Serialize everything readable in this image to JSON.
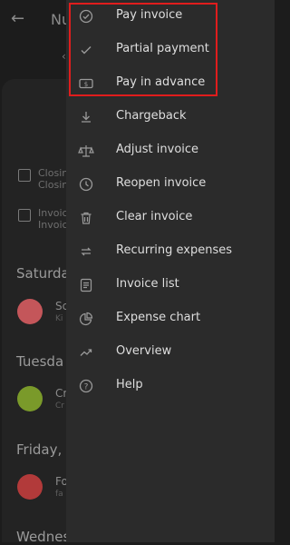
{
  "background": {
    "title": "Nu",
    "info_rows": [
      {
        "line1": "Closin",
        "line2": "Closin"
      },
      {
        "line1": "Invoic",
        "line2": "Invoic"
      }
    ],
    "days": [
      "Saturda",
      "Tuesda",
      "Friday,",
      "Wednes"
    ],
    "avatars": [
      {
        "text": "Sc",
        "sub": "Ki",
        "color": "#c4565a"
      },
      {
        "text": "Cr",
        "sub": "Cr",
        "color": "#7a9a2a"
      },
      {
        "text": "Fo",
        "sub": "fa",
        "color": "#b23a3a"
      }
    ]
  },
  "menu": {
    "items": [
      {
        "label": "Pay invoice",
        "icon": "check-circle-icon"
      },
      {
        "label": "Partial payment",
        "icon": "check-icon"
      },
      {
        "label": "Pay in advance",
        "icon": "money-icon"
      },
      {
        "label": "Chargeback",
        "icon": "download-icon"
      },
      {
        "label": "Adjust invoice",
        "icon": "scale-icon"
      },
      {
        "label": "Reopen invoice",
        "icon": "clock-icon"
      },
      {
        "label": "Clear invoice",
        "icon": "trash-icon"
      },
      {
        "label": "Recurring expenses",
        "icon": "repeat-icon"
      },
      {
        "label": "Invoice list",
        "icon": "list-icon"
      },
      {
        "label": "Expense chart",
        "icon": "pie-chart-icon"
      },
      {
        "label": "Overview",
        "icon": "trend-icon"
      },
      {
        "label": "Help",
        "icon": "help-icon"
      }
    ]
  },
  "colors": {
    "highlight": "#e01d1d",
    "menu_bg": "#2b2b2b",
    "page_bg": "#1c1c1c"
  }
}
